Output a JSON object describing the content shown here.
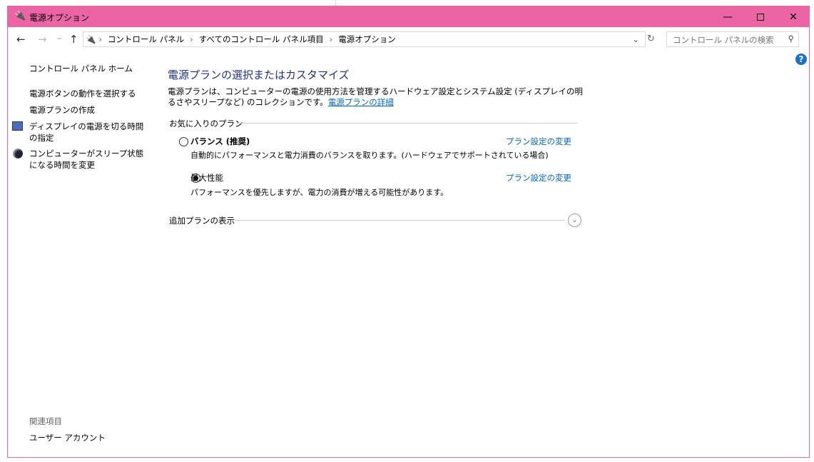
{
  "window": {
    "title": "電源オプション"
  },
  "nav": {
    "breadcrumb": [
      "コントロール パネル",
      "すべてのコントロール パネル項目",
      "電源オプション"
    ],
    "search_placeholder": "コントロール パネルの検索"
  },
  "sidebar": {
    "home": "コントロール パネル ホーム",
    "items": [
      "電源ボタンの動作を選択する",
      "電源プランの作成",
      "ディスプレイの電源を切る時間の指定",
      "コンピューターがスリープ状態になる時間を変更"
    ],
    "related_heading": "関連項目",
    "related": [
      "ユーザー アカウント"
    ]
  },
  "main": {
    "heading": "電源プランの選択またはカスタマイズ",
    "description": "電源プランは、コンピューターの電源の使用方法を管理するハードウェア設定とシステム設定 (ディスプレイの明るさやスリープなど) のコレクションです。",
    "details_link": "電源プランの詳細",
    "favorites_label": "お気に入りのプラン",
    "plans": [
      {
        "name": "バランス (推奨)",
        "desc": "自動的にパフォーマンスと電力消費のバランスを取ります。(ハードウェアでサポートされている場合)",
        "change": "プラン設定の変更",
        "selected": false
      },
      {
        "name": "最大性能",
        "desc": "パフォーマンスを優先しますが、電力の消費が増える可能性があります。",
        "change": "プラン設定の変更",
        "selected": true
      }
    ],
    "more_plans": "追加プランの表示"
  }
}
